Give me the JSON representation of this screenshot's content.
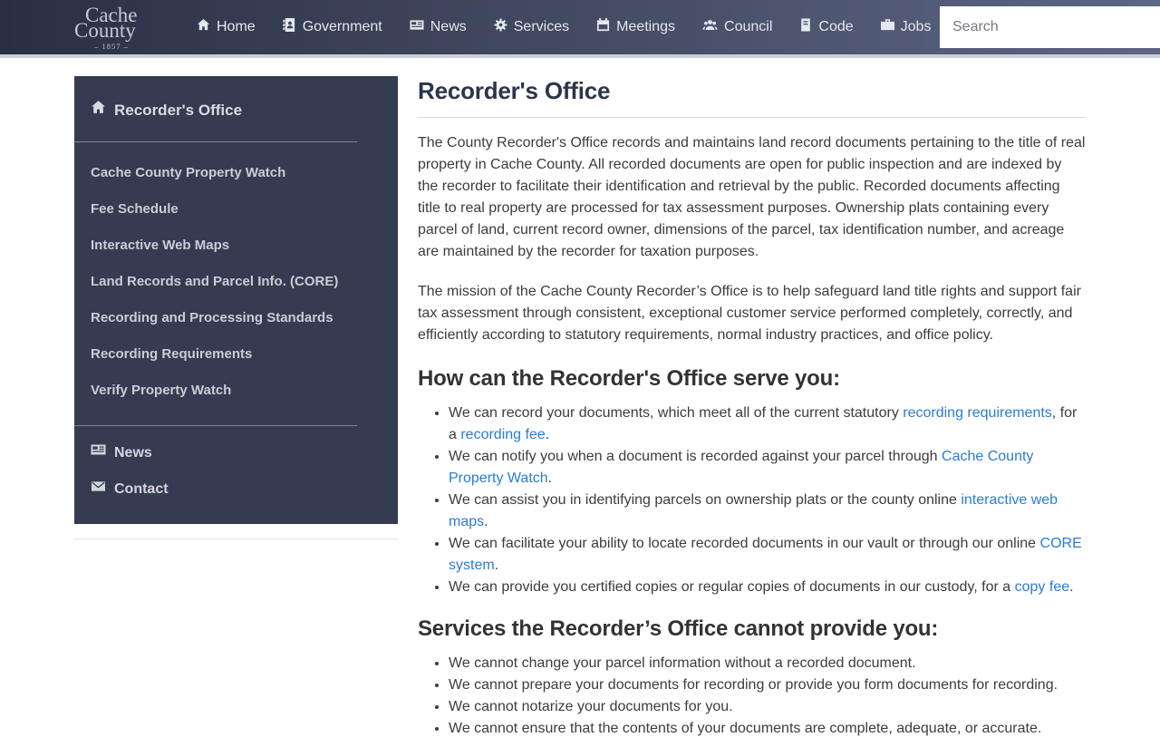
{
  "navbar": {
    "logo": {
      "line1": "Cache",
      "line2": "County",
      "year": "– 1857 –"
    },
    "items": [
      "Home",
      "Government",
      "News",
      "Services",
      "Meetings",
      "Council",
      "Code",
      "Jobs"
    ],
    "search_placeholder": "Search"
  },
  "sidebar": {
    "title": "Recorder's Office",
    "items": [
      "Cache County Property Watch",
      "Fee Schedule",
      "Interactive Web Maps",
      "Land Records and Parcel Info. (CORE)",
      "Recording and Processing Standards",
      "Recording Requirements",
      "Verify Property Watch"
    ],
    "footer_items": [
      "News",
      "Contact"
    ]
  },
  "main": {
    "title": "Recorder's Office",
    "paragraphs": [
      "The County Recorder's Office records and maintains land record documents pertaining to the title of real property in Cache County. All recorded documents are open for public inspection and are indexed by the recorder to facilitate their identification and retrieval by the public. Recorded documents affecting title to real property are processed for tax assessment purposes. Ownership plats containing every parcel of land, current record owner, dimensions of the parcel, tax identification number, and acreage are maintained by the recorder for taxation purposes.",
      "The mission of the Cache County Recorder’s Office is to help safeguard land title rights and support fair tax assessment through consistent, exceptional customer service performed completely, correctly, and efficiently according to statutory requirements, normal industry practices, and office policy."
    ],
    "serve_heading": "How can the Recorder's Office serve you:",
    "serve_items": [
      [
        {
          "t": "We can record your documents, which meet all of the current statutory "
        },
        {
          "t": "recording requirements",
          "link": true
        },
        {
          "t": ", for a "
        },
        {
          "t": "recording fee",
          "link": true
        },
        {
          "t": "."
        }
      ],
      [
        {
          "t": "We can notify you when a document is recorded against your parcel through "
        },
        {
          "t": "Cache County Property Watch",
          "link": true
        },
        {
          "t": "."
        }
      ],
      [
        {
          "t": "We can assist you in identifying parcels on ownership plats or the county online "
        },
        {
          "t": "interactive web maps",
          "link": true
        },
        {
          "t": "."
        }
      ],
      [
        {
          "t": "We can facilitate your ability to locate recorded documents in our vault or through our online "
        },
        {
          "t": "CORE system",
          "link": true
        },
        {
          "t": "."
        }
      ],
      [
        {
          "t": "We can provide you certified copies or regular copies of documents in our custody, for a "
        },
        {
          "t": "copy fee",
          "link": true
        },
        {
          "t": "."
        }
      ]
    ],
    "cannot_heading": "Services the Recorder’s Office cannot provide you:",
    "cannot_items": [
      [
        {
          "t": "We cannot change your parcel information without a recorded document."
        }
      ],
      [
        {
          "t": "We cannot prepare your documents for recording or provide you form documents for recording."
        }
      ],
      [
        {
          "t": "We cannot notarize your documents for you."
        }
      ],
      [
        {
          "t": "We cannot ensure that the contents of your documents are complete, adequate, or accurate."
        }
      ]
    ]
  },
  "colors": {
    "link": "#2b7cd3",
    "navbar_gradient_left": "#2a3043",
    "navbar_gradient_right": "#5d6683",
    "sidebar_bg": "#353b50"
  }
}
